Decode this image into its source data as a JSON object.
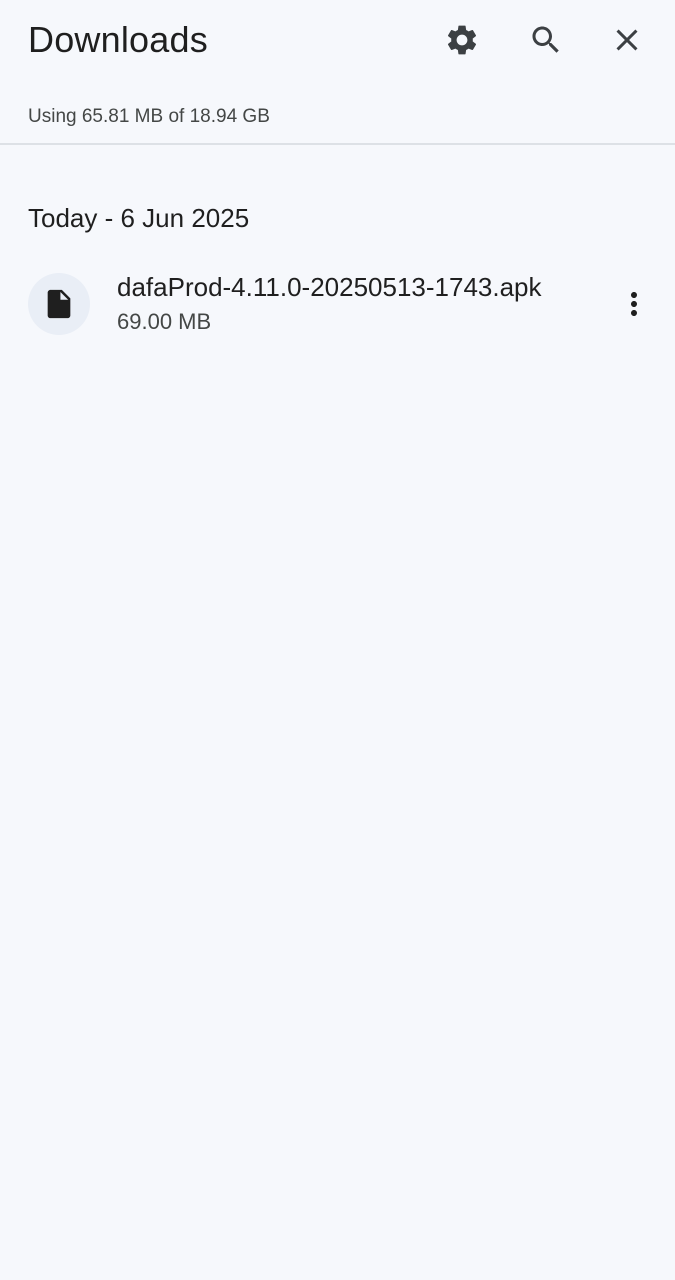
{
  "header": {
    "title": "Downloads",
    "icons": {
      "settings": "gear-icon",
      "search": "search-icon",
      "close": "close-icon"
    }
  },
  "storage": {
    "text": "Using 65.81 MB of 18.94 GB"
  },
  "sections": [
    {
      "date_label": "Today - 6 Jun 2025",
      "items": [
        {
          "name": "dafaProd-4.11.0-20250513-1743.apk",
          "size": "69.00 MB",
          "icon": "file-icon",
          "menu_icon": "more-vertical-icon"
        }
      ]
    }
  ],
  "colors": {
    "background": "#f6f8fc",
    "text_primary": "#1f1f1f",
    "text_secondary": "#444746",
    "icon": "#3c4043",
    "thumb_bg": "#e9eef6",
    "divider": "#dde1e6"
  }
}
